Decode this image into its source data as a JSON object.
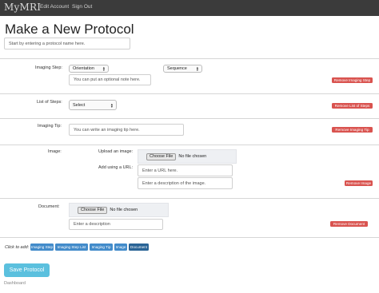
{
  "navbar": {
    "brand": "MyMRI",
    "links": [
      "Edit Account",
      "Sign Out"
    ]
  },
  "page": {
    "title": "Make a New Protocol"
  },
  "protocol_name": {
    "placeholder": "Start by entering a protocol name here."
  },
  "imaging_step": {
    "label": "Imaging Step:",
    "select_value": "Orientation",
    "sequence_value": "Sequence",
    "note_placeholder": "You can put an optional note here.",
    "remove_label": "Remove Imaging Step"
  },
  "list_of_steps": {
    "label": "List of Steps:",
    "select_value": "Select",
    "remove_label": "Remove List of Steps"
  },
  "imaging_tip": {
    "label": "Imaging Tip:",
    "placeholder": "You can write an imaging tip here.",
    "remove_label": "Remove Imaging Tip"
  },
  "image": {
    "label": "Image:",
    "upload_label": "Upload an image:",
    "url_label": "Add using a URL:",
    "choose_file": "Choose File",
    "no_file": "No file chosen",
    "url_placeholder": "Enter a URL here.",
    "desc_placeholder": "Enter a description of the image.",
    "remove_label": "Remove Image"
  },
  "document": {
    "label": "Document:",
    "choose_file": "Choose File",
    "no_file": "No file chosen",
    "desc_placeholder": "Enter a description",
    "remove_label": "Remove Document"
  },
  "add_bar": {
    "label": "Click to add:",
    "buttons": [
      "Imaging Step",
      "Imaging Step List",
      "Imaging Tip",
      "Image",
      "Document"
    ]
  },
  "save_label": "Save Protocol",
  "footer_link": "Dashboard",
  "colors": {
    "navbar": "#3b3b3b",
    "danger": "#d9534f",
    "primary": "#428bca",
    "info": "#5bc0de"
  }
}
